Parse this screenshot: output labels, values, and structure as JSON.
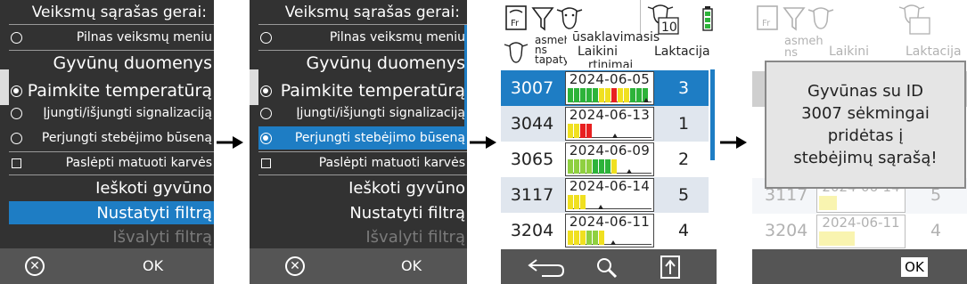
{
  "panel1": {
    "title": "Veiksmų sąrašas gerai:",
    "items": [
      {
        "label": "Pilnas veiksmų meniu",
        "mark": "radio"
      },
      {
        "label": "Gyvūnų duomenys",
        "mark": "none"
      },
      {
        "label": "Paimkite temperatūrą",
        "mark": "radio-on"
      },
      {
        "label": "Įjungti/išjungti signalizaciją",
        "mark": "radio"
      },
      {
        "label": "Perjungti stebėjimo būseną",
        "mark": "radio"
      },
      {
        "label": "Paslėpti matuoti karvės",
        "mark": "checkbox"
      },
      {
        "label": "Ieškoti gyvūno",
        "mark": "none"
      },
      {
        "label": "Nustatyti filtrą",
        "mark": "none",
        "selected": true
      },
      {
        "label": "Išvalyti filtrą",
        "mark": "none",
        "disabled": true
      }
    ],
    "cancel_icon": "circle-x-icon",
    "ok_label": "OK"
  },
  "panel2": {
    "title": "Veiksmų sąrašas gerai:",
    "items": [
      {
        "label": "Pilnas veiksmų meniu",
        "mark": "radio"
      },
      {
        "label": "Gyvūnų duomenys",
        "mark": "none"
      },
      {
        "label": "Paimkite temperatūrą",
        "mark": "radio-on"
      },
      {
        "label": "Įjungti/išjungti signalizaciją",
        "mark": "radio"
      },
      {
        "label": "Perjungti stebėjimo būseną",
        "mark": "radio",
        "selected": true
      },
      {
        "label": "Paslėpti matuoti karvės",
        "mark": "checkbox"
      },
      {
        "label": "Ieškoti gyvūno",
        "mark": "none"
      },
      {
        "label": "Nustatyti filtrą",
        "mark": "none"
      },
      {
        "label": "Išvalyti filtrą",
        "mark": "none",
        "disabled": true
      }
    ],
    "cancel_icon": "circle-x-icon",
    "ok_label": "OK"
  },
  "panel3": {
    "header_icons": [
      "fr-tag-icon",
      "filter-icon",
      "cow-head-icon",
      "cow-count-icon",
      "battery-icon"
    ],
    "cow_count": "10",
    "columns": {
      "id": "asmeh ns tapaty",
      "bar": "Laikini",
      "bar_overlay": "ūsaklavimasis",
      "bar_overlay2": "rtinimai",
      "lact": "Laktacija"
    },
    "rows": [
      {
        "id": "3007",
        "date": "2024-06-05",
        "lact": "3",
        "selected": true,
        "cells": [
          "#2db33a",
          "#2db33a",
          "#2db33a",
          "#2db33a",
          "#2db33a",
          "#f0e020",
          "#f0e020",
          "#e82020",
          "#f0e020",
          "#f0e020",
          "#2db33a",
          "#2db33a",
          "#2db33a"
        ],
        "marker": 0.93
      },
      {
        "id": "3044",
        "date": "2024-06-13",
        "lact": "1",
        "cells": [
          "#f0e020",
          "#f0e020",
          "#e82020",
          "#e82020"
        ],
        "marker": 0.55
      },
      {
        "id": "3065",
        "date": "2024-06-09",
        "lact": "2",
        "cells": [
          "#8fd040",
          "#8fd040",
          "#8fd040",
          "#8fd040",
          "#2db33a",
          "#2db33a",
          "#2db33a",
          "#f0e020"
        ],
        "marker": 0.72
      },
      {
        "id": "3117",
        "date": "2024-06-14",
        "lact": "5",
        "cells": [
          "#f0e020",
          "#f0e020",
          "#f0e020"
        ],
        "marker": 0.38
      },
      {
        "id": "3204",
        "date": "2024-06-11",
        "lact": "4",
        "cells": [
          "#f0e020",
          "#f0e020",
          "#f0e020",
          "#8fd040",
          "#8fd040",
          "#f0e020"
        ],
        "marker": 0.53
      }
    ],
    "back_icon": "back-arrow-icon",
    "search_icon": "search-icon",
    "upload_icon": "upload-box-icon"
  },
  "panel4": {
    "message": "Gyvūnas su ID\n3007 sėkmingai\npridėtas į\nstebėjimų sąrašą!",
    "ok_label": "OK",
    "bg_columns": {
      "id": "asmeh ns",
      "bar": "Laikini",
      "lact": "Laktacija"
    },
    "bg_rows": [
      {
        "id": "3117",
        "date": "2024-06-14",
        "lact": "5"
      },
      {
        "id": "3204",
        "date": "2024-06-11",
        "lact": "4"
      }
    ]
  },
  "colors": {
    "selected": "#1e7dc4",
    "menu_bg": "#323232",
    "footer": "#555555",
    "row_alt": "#e0e6ee"
  }
}
